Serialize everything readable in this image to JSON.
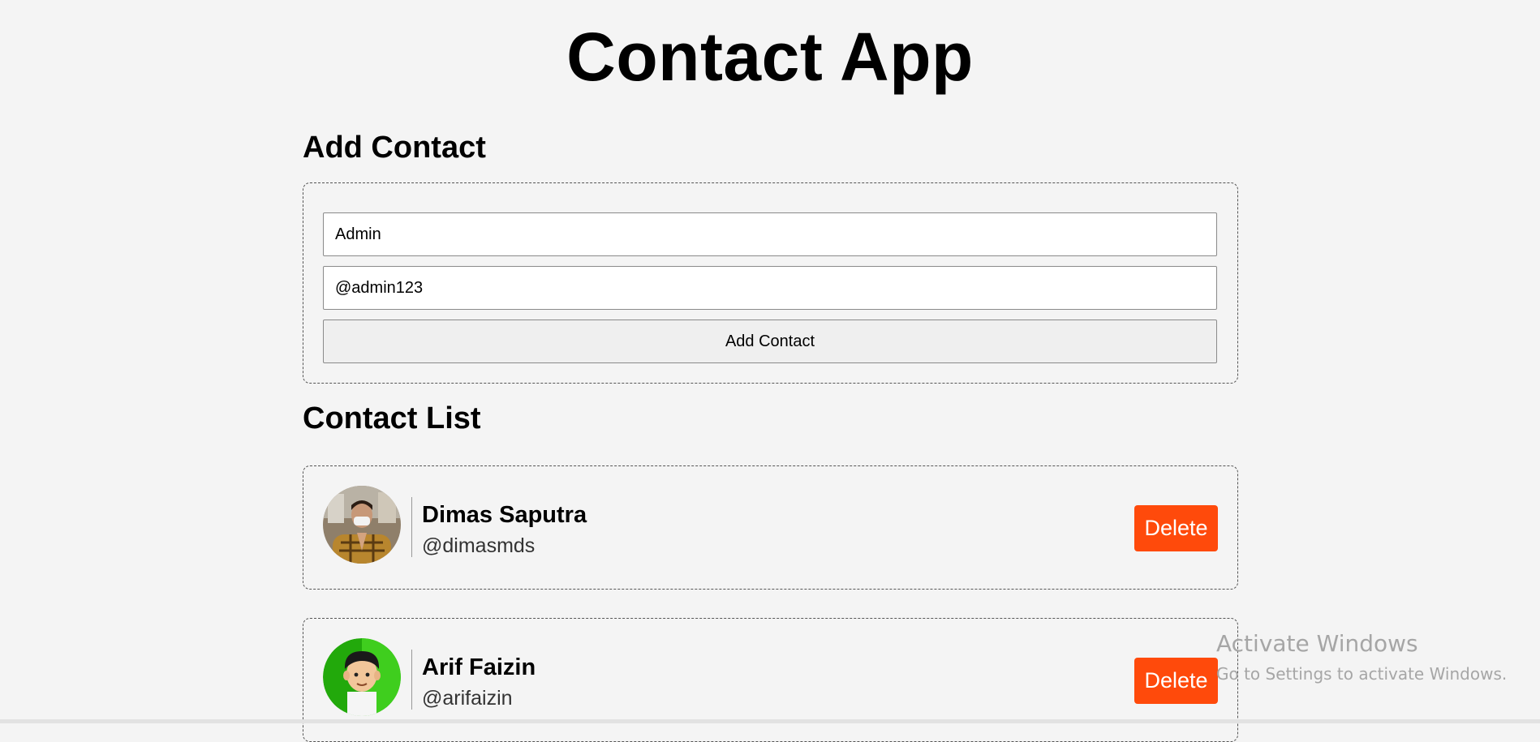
{
  "app": {
    "title": "Contact App"
  },
  "add_section": {
    "heading": "Add Contact",
    "name_value": "Admin",
    "username_value": "@admin123",
    "button_label": "Add Contact"
  },
  "list_section": {
    "heading": "Contact List",
    "contacts": [
      {
        "name": "Dimas Saputra",
        "username": "@dimasmds",
        "delete_label": "Delete",
        "avatar_icon": "person-photo"
      },
      {
        "name": "Arif Faizin",
        "username": "@arifaizin",
        "delete_label": "Delete",
        "avatar_icon": "cartoon-avatar"
      }
    ]
  },
  "watermark": {
    "title": "Activate Windows",
    "subtitle": "Go to Settings to activate Windows."
  },
  "colors": {
    "delete": "#ff4a0b",
    "background": "#f4f4f4"
  }
}
